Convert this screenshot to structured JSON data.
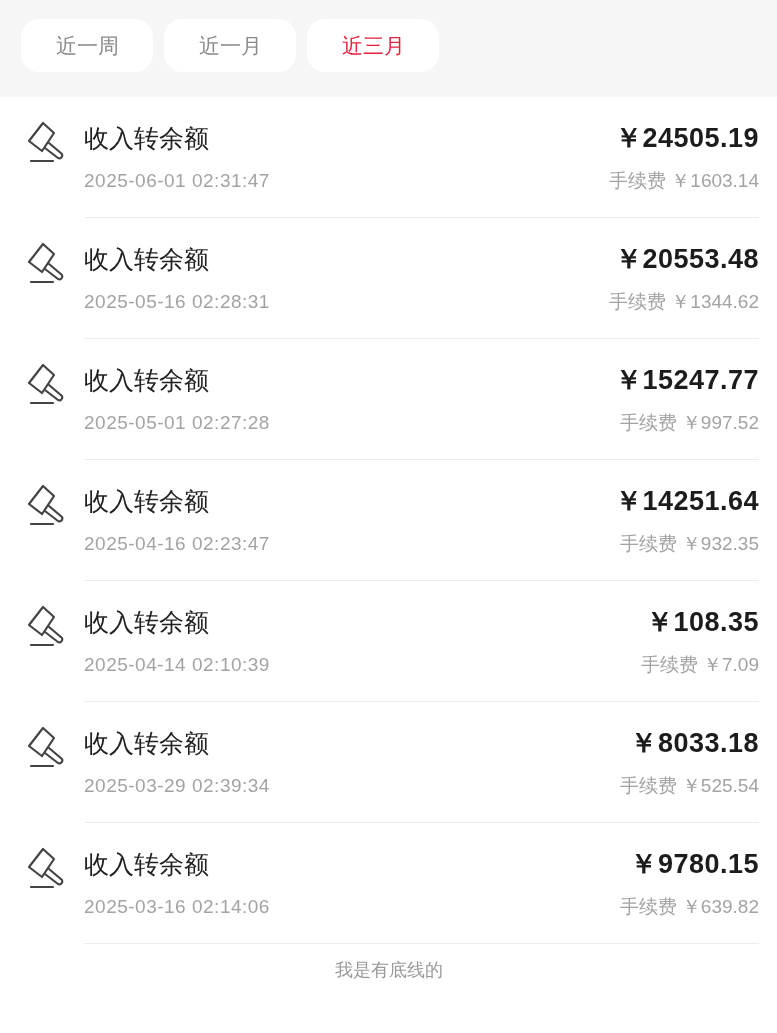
{
  "tabs": [
    {
      "label": "近一周",
      "selected": false
    },
    {
      "label": "近一月",
      "selected": false
    },
    {
      "label": "近三月",
      "selected": true
    }
  ],
  "records": [
    {
      "title": "收入转余额",
      "time": "2025-06-01 02:31:47",
      "amount": "￥24505.19",
      "fee": "手续费 ￥1603.14"
    },
    {
      "title": "收入转余额",
      "time": "2025-05-16 02:28:31",
      "amount": "￥20553.48",
      "fee": "手续费 ￥1344.62"
    },
    {
      "title": "收入转余额",
      "time": "2025-05-01 02:27:28",
      "amount": "￥15247.77",
      "fee": "手续费 ￥997.52"
    },
    {
      "title": "收入转余额",
      "time": "2025-04-16 02:23:47",
      "amount": "￥14251.64",
      "fee": "手续费 ￥932.35"
    },
    {
      "title": "收入转余额",
      "time": "2025-04-14 02:10:39",
      "amount": "￥108.35",
      "fee": "手续费 ￥7.09"
    },
    {
      "title": "收入转余额",
      "time": "2025-03-29 02:39:34",
      "amount": "￥8033.18",
      "fee": "手续费 ￥525.54"
    },
    {
      "title": "收入转余额",
      "time": "2025-03-16 02:14:06",
      "amount": "￥9780.15",
      "fee": "手续费 ￥639.82"
    }
  ],
  "footer": "我是有底线的"
}
